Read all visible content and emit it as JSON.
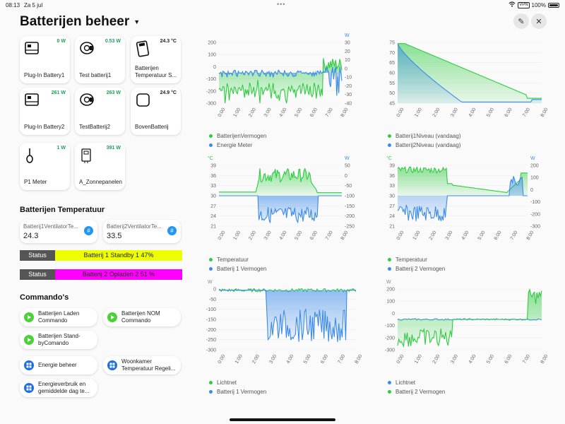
{
  "status_bar": {
    "time": "08:13",
    "date": "Za 5 jul",
    "vpn": "VPN",
    "battery": "100%"
  },
  "header": {
    "title": "Batterijen beheer"
  },
  "tiles": [
    {
      "name": "Plug-In Battery1",
      "value": "0 W",
      "color": "#1ea05a",
      "icon": "battery-device-icon"
    },
    {
      "name": "Test batterij1",
      "value": "0.53 W",
      "color": "#1ea05a",
      "icon": "plug-icon"
    },
    {
      "name": "Batterijen Temperatuur S...",
      "value": "24.3 °C",
      "color": "#222222",
      "icon": "thermometer-sensor-icon"
    },
    {
      "name": "Plug-In Battery2",
      "value": "261 W",
      "color": "#1ea05a",
      "icon": "battery-device-icon"
    },
    {
      "name": "TestBatterij2",
      "value": "263 W",
      "color": "#1ea05a",
      "icon": "plug-icon"
    },
    {
      "name": "BovenBatterij",
      "value": "24.9 °C",
      "color": "#222222",
      "icon": "sensor-box-icon"
    },
    {
      "name": "P1 Meter",
      "value": "1 W",
      "color": "#1ea05a",
      "icon": "p1-meter-icon"
    },
    {
      "name": "A_Zonnepanelen",
      "value": "391 W",
      "color": "#1ea05a",
      "icon": "inverter-icon"
    }
  ],
  "temps": {
    "title": "Batterijen Temperatuur",
    "f1": {
      "label": "Batterij1VentilatorTe...",
      "value": "24.3"
    },
    "f2": {
      "label": "Batterij2VentilatorTe...",
      "value": "33.5"
    }
  },
  "status1": {
    "key": "Status",
    "value": "Batterij 1 Standby 1 47%",
    "color": "#eeff00"
  },
  "status2": {
    "key": "Status",
    "value": "Batterij 2 Opladen 2 51 %",
    "color": "#ff00ff"
  },
  "commands": {
    "title": "Commando's",
    "items": [
      {
        "label": "Batterijen Laden Commando",
        "icon": "play-icon"
      },
      {
        "label": "Batterijen NOM Commando",
        "icon": "play-icon"
      },
      {
        "label": "Batterijen Stand-byComando",
        "icon": "play-icon"
      },
      {
        "label": "Energie beheer",
        "icon": "dashboard-icon"
      },
      {
        "label": "Woonkamer Temperatuur Regeli...",
        "icon": "dashboard-icon"
      },
      {
        "label": "Energieverbruik en gemiddelde dag te...",
        "icon": "dashboard-icon"
      }
    ]
  },
  "colors": {
    "green": "#2ecc40",
    "blue": "#3b8beb"
  },
  "chart_data": [
    {
      "id": "c1",
      "type": "area",
      "x_ticks": [
        "0:00",
        "1:00",
        "2:00",
        "3:00",
        "4:00",
        "5:00",
        "6:00",
        "7:00",
        "8:00"
      ],
      "left_unit": "",
      "left_ticks": [
        200,
        100,
        0,
        -100,
        -200,
        -300
      ],
      "right_unit": "W",
      "right_ticks": [
        30,
        20,
        10,
        0,
        -10,
        -20,
        -30,
        -40
      ],
      "series": [
        {
          "name": "BatterijenVermogen",
          "color": "#2ecc40",
          "axis": "left"
        },
        {
          "name": "Energie Meter",
          "color": "#3b8beb",
          "axis": "left"
        }
      ]
    },
    {
      "id": "c2",
      "type": "area",
      "x_ticks": [
        "0:00",
        "1:00",
        "2:00",
        "3:00",
        "4:00",
        "5:00",
        "6:00",
        "7:00",
        "8:00"
      ],
      "left_unit": "",
      "left_ticks": [
        75,
        70,
        65,
        60,
        55,
        50,
        45
      ],
      "series": [
        {
          "name": "Batterij1Niveau (vandaag)",
          "color": "#2ecc40",
          "axis": "left"
        },
        {
          "name": "Batterij2Niveau (vandaag)",
          "color": "#3b8beb",
          "axis": "left"
        }
      ]
    },
    {
      "id": "c3",
      "type": "area",
      "x_ticks": [
        "0:00",
        "1:00",
        "2:00",
        "3:00",
        "4:00",
        "5:00",
        "6:00",
        "7:00",
        "8:00"
      ],
      "left_unit": "°C",
      "left_ticks": [
        39,
        36,
        33,
        30,
        27,
        24,
        21
      ],
      "right_unit": "W",
      "right_ticks": [
        50,
        0,
        -50,
        -100,
        -150,
        -200,
        -250
      ],
      "series": [
        {
          "name": "Temperatuur",
          "color": "#2ecc40",
          "axis": "left"
        },
        {
          "name": "Batterij 1 Vermogen",
          "color": "#3b8beb",
          "axis": "right"
        }
      ]
    },
    {
      "id": "c4",
      "type": "area",
      "x_ticks": [
        "0:00",
        "1:00",
        "2:00",
        "3:00",
        "4:00",
        "5:00",
        "6:00",
        "7:00",
        "8:00"
      ],
      "left_unit": "°C",
      "left_ticks": [
        39,
        36,
        33,
        30,
        27,
        24,
        21
      ],
      "right_unit": "W",
      "right_ticks": [
        200,
        100,
        0,
        -100,
        -200,
        -300
      ],
      "series": [
        {
          "name": "Temperatuur",
          "color": "#2ecc40",
          "axis": "left"
        },
        {
          "name": "Batterij 2 Vermogen",
          "color": "#3b8beb",
          "axis": "right"
        }
      ]
    },
    {
      "id": "c5",
      "type": "area",
      "x_ticks": [
        "0:00",
        "1:00",
        "2:00",
        "3:00",
        "4:00",
        "5:00",
        "6:00",
        "7:00",
        "8:00"
      ],
      "left_unit": "W",
      "left_ticks": [
        0,
        -50,
        -100,
        -150,
        -200,
        -250,
        -300
      ],
      "series": [
        {
          "name": "Lichtnet",
          "color": "#2ecc40",
          "axis": "left"
        },
        {
          "name": "Batterij 1 Vermogen",
          "color": "#3b8beb",
          "axis": "left"
        }
      ]
    },
    {
      "id": "c6",
      "type": "area",
      "x_ticks": [
        "0:00",
        "1:00",
        "2:00",
        "3:00",
        "4:00",
        "5:00",
        "6:00",
        "7:00",
        "8:00"
      ],
      "left_unit": "W",
      "left_ticks": [
        200,
        100,
        0,
        -100,
        -200,
        -300
      ],
      "series": [
        {
          "name": "Lichtnet",
          "color": "#3b8beb",
          "axis": "left"
        },
        {
          "name": "Batterij 2 Vermogen",
          "color": "#2ecc40",
          "axis": "left"
        }
      ]
    }
  ]
}
